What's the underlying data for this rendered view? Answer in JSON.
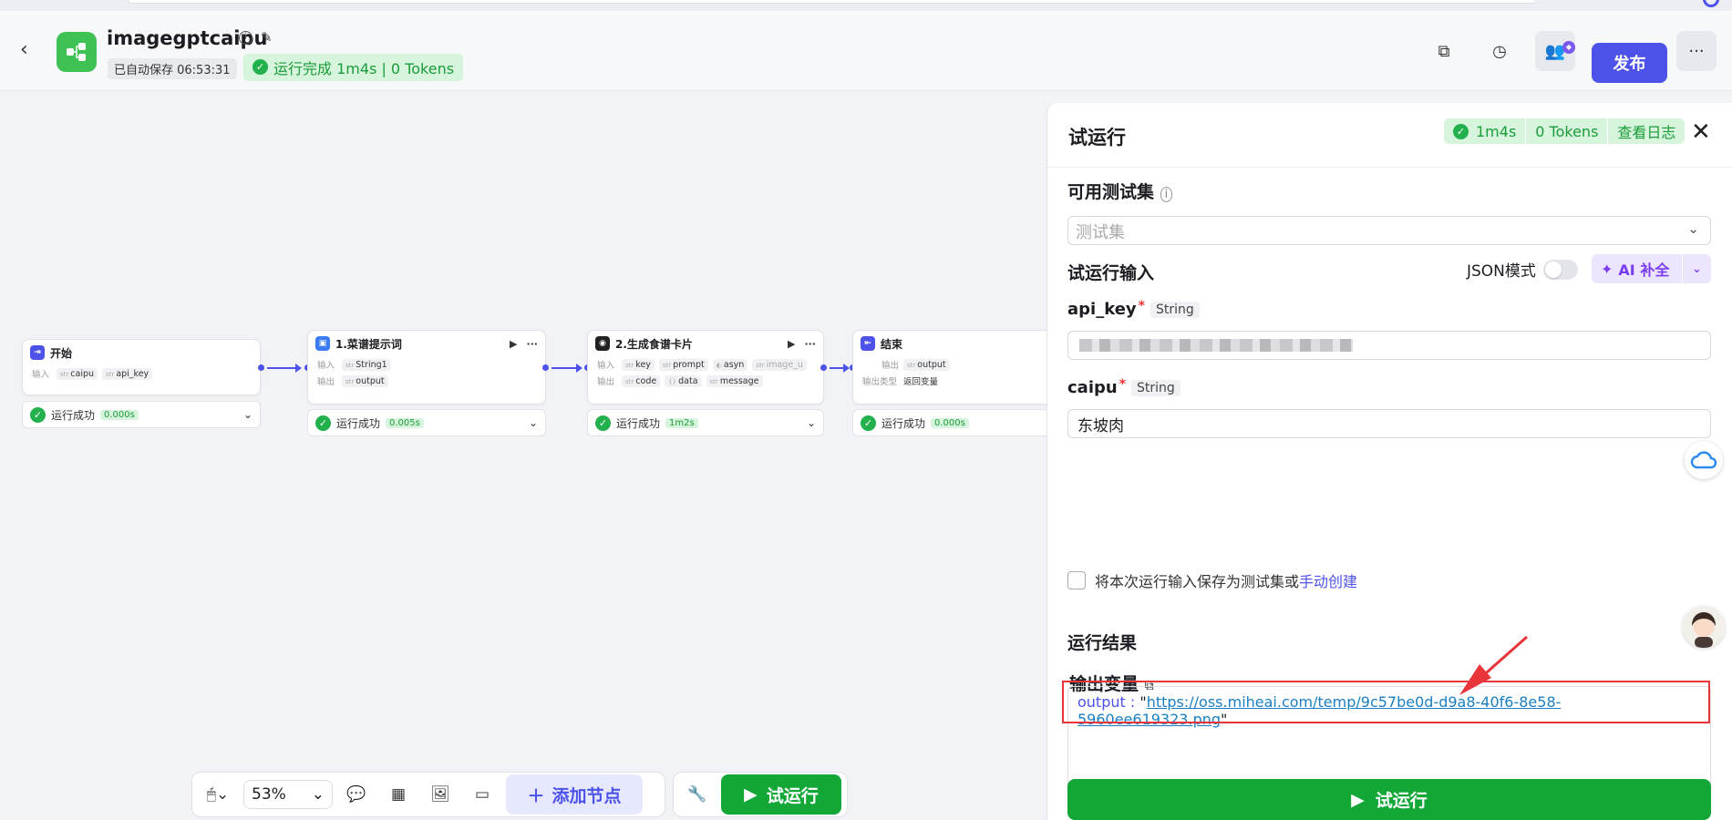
{
  "header": {
    "app_name": "imagegptcaipu",
    "autosave": "已自动保存 06:53:31",
    "run_status": "运行完成 1m4s | 0 Tokens",
    "publish_label": "发布"
  },
  "nodes": [
    {
      "title": "开始",
      "in_label": "输入",
      "inputs": [
        "caipu",
        "api_key"
      ],
      "status": "运行成功",
      "time": "0.000s"
    },
    {
      "title": "1.菜谱提示词",
      "in_label": "输入",
      "out_label": "输出",
      "inputs": [
        "String1"
      ],
      "outputs": [
        "output"
      ],
      "status": "运行成功",
      "time": "0.005s"
    },
    {
      "title": "2.生成食谱卡片",
      "in_label": "输入",
      "out_label": "输出",
      "inputs": [
        "key",
        "prompt",
        "asyn",
        "image_u"
      ],
      "outputs": [
        "code",
        "data",
        "message"
      ],
      "status": "运行成功",
      "time": "1m2s"
    },
    {
      "title": "结束",
      "out_label": "输出",
      "type_label": "输出类型",
      "outputs": [
        "output"
      ],
      "return_type": "返回变量",
      "status": "运行成功",
      "time": "0.000s"
    }
  ],
  "toolbar": {
    "zoom": "53%",
    "add_node": "添加节点",
    "test_run": "试运行"
  },
  "panel": {
    "title": "试运行",
    "badge_time": "1m4s",
    "badge_tokens": "0 Tokens",
    "view_log": "查看日志",
    "testset_label": "可用测试集",
    "testset_placeholder": "测试集",
    "run_input_label": "试运行输入",
    "json_mode": "JSON模式",
    "ai_fill": "AI 补全",
    "fields": [
      {
        "name": "api_key",
        "type": "String",
        "value": ""
      },
      {
        "name": "caipu",
        "type": "String",
        "value": "东坡肉"
      }
    ],
    "save_prefix": "将本次运行输入保存为测试集或",
    "save_link": "手动创建",
    "result_label": "运行结果",
    "output_var_label": "输出变量",
    "output_key": "output",
    "output_url": "https://oss.miheai.com/temp/9c57be0d-d9a8-40f6-8e58-5960ee619323.png",
    "run_button": "试运行"
  },
  "colors": {
    "accent": "#4d53e8",
    "success": "#12a736",
    "highlight": "#e8353a"
  }
}
